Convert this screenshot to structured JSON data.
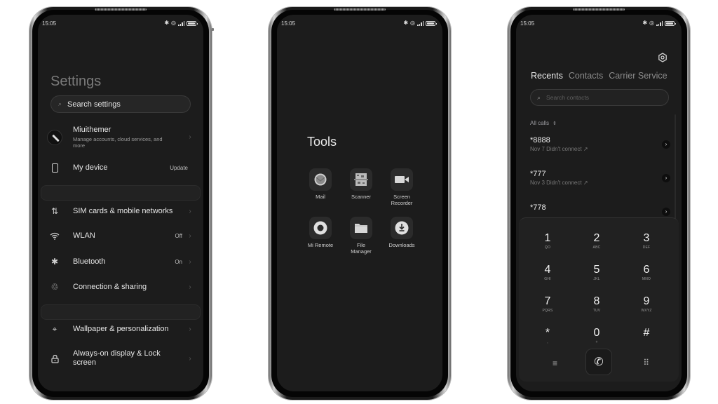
{
  "status_bar": {
    "time": "15:05"
  },
  "settings": {
    "title": "Settings",
    "search_placeholder": "Search settings",
    "account": {
      "name": "Miuithemer",
      "subtitle": "Manage accounts, cloud services, and more"
    },
    "my_device": {
      "label": "My device",
      "value": "Update"
    },
    "items": [
      {
        "icon": "sim-icon",
        "label": "SIM cards & mobile networks",
        "value": ""
      },
      {
        "icon": "wifi-icon",
        "label": "WLAN",
        "value": "Off"
      },
      {
        "icon": "bluetooth-icon",
        "label": "Bluetooth",
        "value": "On"
      },
      {
        "icon": "share-icon",
        "label": "Connection & sharing",
        "value": ""
      },
      {
        "icon": "paint-icon",
        "label": "Wallpaper & personalization",
        "value": ""
      },
      {
        "icon": "lock-icon",
        "label": "Always-on display & Lock screen",
        "value": ""
      }
    ]
  },
  "tools": {
    "title": "Tools",
    "apps": [
      {
        "icon": "mail-icon",
        "label": "Mail"
      },
      {
        "icon": "scanner-icon",
        "label": "Scanner"
      },
      {
        "icon": "video-camera-icon",
        "label": "Screen Recorder"
      },
      {
        "icon": "remote-icon",
        "label": "Mi Remote"
      },
      {
        "icon": "folder-icon",
        "label": "File Manager"
      },
      {
        "icon": "download-icon",
        "label": "Downloads"
      }
    ]
  },
  "dialer": {
    "tabs": [
      "Recents",
      "Contacts",
      "Carrier Service"
    ],
    "active_tab": "Recents",
    "search_placeholder": "Search contacts",
    "filter": "All calls",
    "recents": [
      {
        "number": "*8888",
        "detail": "Nov 7 Didn't connect"
      },
      {
        "number": "*777",
        "detail": "Nov 3 Didn't connect"
      },
      {
        "number": "*778",
        "detail": ""
      }
    ],
    "keys": [
      {
        "digit": "1",
        "letters": "QO"
      },
      {
        "digit": "2",
        "letters": "ABC"
      },
      {
        "digit": "3",
        "letters": "DEF"
      },
      {
        "digit": "4",
        "letters": "GHI"
      },
      {
        "digit": "5",
        "letters": "JKL"
      },
      {
        "digit": "6",
        "letters": "MNO"
      },
      {
        "digit": "7",
        "letters": "PQRS"
      },
      {
        "digit": "8",
        "letters": "TUV"
      },
      {
        "digit": "9",
        "letters": "WXYZ"
      },
      {
        "digit": "*",
        "letters": ","
      },
      {
        "digit": "0",
        "letters": "+"
      },
      {
        "digit": "#",
        "letters": ""
      }
    ]
  }
}
